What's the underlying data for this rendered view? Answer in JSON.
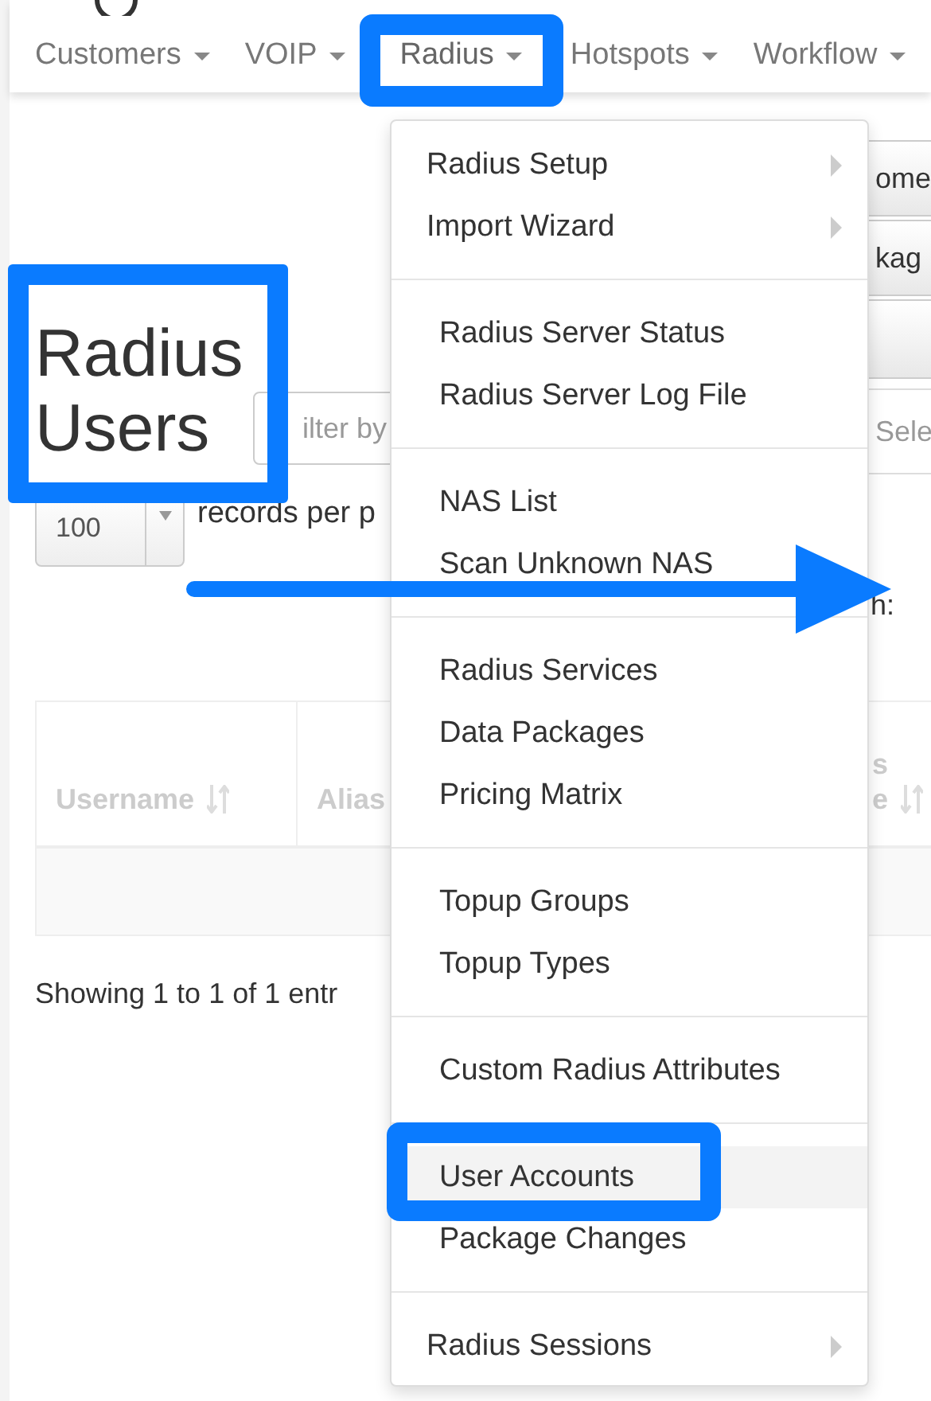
{
  "nav": [
    {
      "label": "Customers",
      "selected": false
    },
    {
      "label": "VOIP",
      "selected": false
    },
    {
      "label": "Radius",
      "selected": true
    },
    {
      "label": "Hotspots",
      "selected": false
    },
    {
      "label": "Workflow",
      "selected": false
    }
  ],
  "menu": {
    "sections": [
      {
        "items": [
          {
            "label": "Radius Setup",
            "kind": "submenu",
            "hovered": false
          },
          {
            "label": "Import Wizard",
            "kind": "submenu",
            "hovered": false
          }
        ]
      },
      {
        "items": [
          {
            "label": "Radius Server Status",
            "kind": "link",
            "hovered": false
          },
          {
            "label": "Radius Server Log File",
            "kind": "link",
            "hovered": false
          }
        ]
      },
      {
        "items": [
          {
            "label": "NAS List",
            "kind": "link",
            "hovered": false
          },
          {
            "label": "Scan Unknown NAS",
            "kind": "link",
            "hovered": false
          }
        ]
      },
      {
        "items": [
          {
            "label": "Radius Services",
            "kind": "link",
            "hovered": false
          },
          {
            "label": "Data Packages",
            "kind": "link",
            "hovered": false
          },
          {
            "label": "Pricing Matrix",
            "kind": "link",
            "hovered": false
          }
        ]
      },
      {
        "items": [
          {
            "label": "Topup Groups",
            "kind": "link",
            "hovered": false
          },
          {
            "label": "Topup Types",
            "kind": "link",
            "hovered": false
          }
        ]
      },
      {
        "items": [
          {
            "label": "Custom Radius Attributes",
            "kind": "link",
            "hovered": false
          }
        ]
      },
      {
        "items": [
          {
            "label": "User Accounts",
            "kind": "link",
            "hovered": true
          },
          {
            "label": "Package Changes",
            "kind": "link",
            "hovered": false
          }
        ]
      },
      {
        "items": [
          {
            "label": "Radius Sessions",
            "kind": "submenu",
            "hovered": false
          }
        ]
      }
    ]
  },
  "page": {
    "title": "Radius Users",
    "filter": {
      "placeholder": "ilter by"
    },
    "page_size": "100",
    "page_size_label": "records per p",
    "side_buttons": [
      "ome",
      "kag"
    ],
    "side_select": {
      "placeholder": "Sele"
    },
    "search_label": "h:"
  },
  "table": {
    "columns": [
      {
        "lines": [
          "Username"
        ],
        "sortable": true
      },
      {
        "lines": [
          "Alias"
        ],
        "sortable": false
      },
      {
        "lines": [
          "s",
          "e"
        ],
        "sortable": true
      }
    ]
  },
  "footer": "Showing 1 to 1 of 1 entr"
}
